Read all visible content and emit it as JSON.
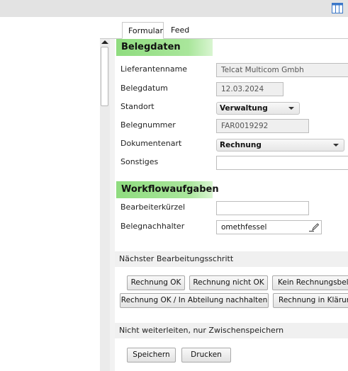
{
  "tabs": {
    "formular": "Formular",
    "feed": "Feed"
  },
  "sections": {
    "belegdaten": "Belegdaten",
    "workflow": "Workflowaufgaben"
  },
  "fields": {
    "lieferantenname": {
      "label": "Lieferantenname",
      "value": "Telcat Multicom Gmbh"
    },
    "belegdatum": {
      "label": "Belegdatum",
      "value": "12.03.2024"
    },
    "standort": {
      "label": "Standort",
      "value": "Verwaltung"
    },
    "belegnummer": {
      "label": "Belegnummer",
      "value": "FAR0019292"
    },
    "dokumentenart": {
      "label": "Dokumentenart",
      "value": "Rechnung"
    },
    "sonstiges": {
      "label": "Sonstiges",
      "value": ""
    },
    "bearbeiterkuerzel": {
      "label": "Bearbeiterkürzel",
      "value": ""
    },
    "belegnachhalter": {
      "label": "Belegnachhalter",
      "value": "omethfessel"
    }
  },
  "next_step": {
    "title": "Nächster Bearbeitungsschritt",
    "buttons": [
      "Rechnung OK",
      "Rechnung nicht OK",
      "Kein Rechnungsbeleg",
      "Rechnung OK / In Abteilung nachhalten",
      "Rechnung in Klärung"
    ]
  },
  "save_section": {
    "title": "Nicht weiterleiten, nur Zwischenspeichern",
    "save_label": "Speichern",
    "print_label": "Drucken"
  },
  "icons": {
    "toolbar": "columns-icon",
    "edit": "pencil-icon"
  }
}
